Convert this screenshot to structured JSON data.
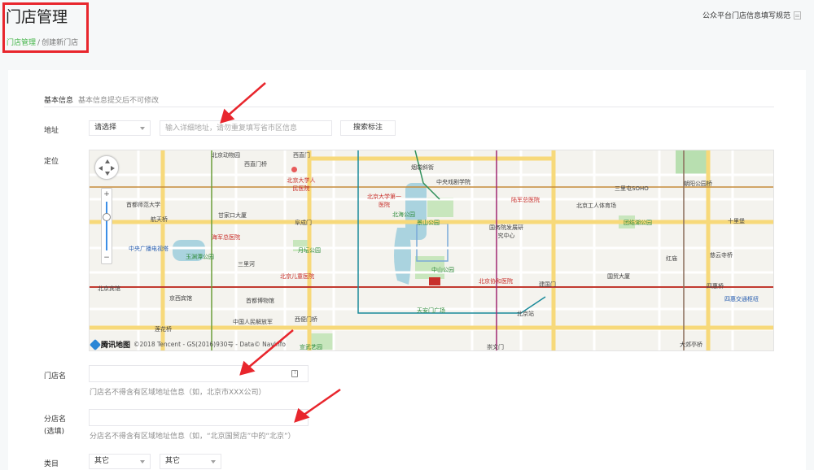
{
  "header": {
    "title": "门店管理",
    "breadcrumb_root": "门店管理",
    "breadcrumb_sep": "/",
    "breadcrumb_current": "创建新门店",
    "spec_link": "公众平台门店信息填写规范"
  },
  "basic_info": {
    "title": "基本信息",
    "subtitle": "基本信息提交后不可修改"
  },
  "address": {
    "label": "地址",
    "region_select": "请选择",
    "detail_placeholder": "输入详细地址，请勿重复填写省市区信息",
    "search_button": "搜索标注"
  },
  "location": {
    "label": "定位"
  },
  "map": {
    "logo_text": "腾讯地图",
    "copyright": "©2018 Tencent - GS(2016)930号 - Data© NavInfo",
    "labels": [
      {
        "text": "北京动物园",
        "cls": ""
      },
      {
        "text": "西直门桥",
        "cls": ""
      },
      {
        "text": "西直门",
        "cls": ""
      },
      {
        "text": "北京大学人民医院",
        "cls": "red"
      },
      {
        "text": "首都师范大学",
        "cls": ""
      },
      {
        "text": "航天桥",
        "cls": ""
      },
      {
        "text": "甘家口大厦",
        "cls": ""
      },
      {
        "text": "阜成门",
        "cls": ""
      },
      {
        "text": "海军总医院",
        "cls": "red"
      },
      {
        "text": "中央广播电视塔",
        "cls": "blue"
      },
      {
        "text": "玉渊潭公园",
        "cls": "green"
      },
      {
        "text": "三里河",
        "cls": ""
      },
      {
        "text": "月坛公园",
        "cls": "green"
      },
      {
        "text": "北京儿童医院",
        "cls": "red"
      },
      {
        "text": "北京宾馆",
        "cls": ""
      },
      {
        "text": "京西宾馆",
        "cls": ""
      },
      {
        "text": "首都博物馆",
        "cls": ""
      },
      {
        "text": "中国人民解放军",
        "cls": ""
      },
      {
        "text": "西便门桥",
        "cls": ""
      },
      {
        "text": "莲花桥",
        "cls": ""
      },
      {
        "text": "宣武艺园",
        "cls": "green"
      },
      {
        "text": "烟袋斜街",
        "cls": ""
      },
      {
        "text": "中央戏剧学院",
        "cls": ""
      },
      {
        "text": "北京大学第一医院",
        "cls": "red"
      },
      {
        "text": "北海公园",
        "cls": "green"
      },
      {
        "text": "景山公园",
        "cls": "green"
      },
      {
        "text": "陆军总医院",
        "cls": "red"
      },
      {
        "text": "国务院发展研究中心",
        "cls": ""
      },
      {
        "text": "中山公园",
        "cls": "green"
      },
      {
        "text": "北京协和医院",
        "cls": "red"
      },
      {
        "text": "天安门广场",
        "cls": "green"
      },
      {
        "text": "北京站",
        "cls": ""
      },
      {
        "text": "崇文门",
        "cls": ""
      },
      {
        "text": "建国门",
        "cls": ""
      },
      {
        "text": "北京工人体育场",
        "cls": ""
      },
      {
        "text": "三里屯SOHO",
        "cls": ""
      },
      {
        "text": "朝阳公园桥",
        "cls": ""
      },
      {
        "text": "团结湖公园",
        "cls": "green"
      },
      {
        "text": "十里堡",
        "cls": ""
      },
      {
        "text": "慈云寺桥",
        "cls": ""
      },
      {
        "text": "国贸大厦",
        "cls": ""
      },
      {
        "text": "四惠桥",
        "cls": ""
      },
      {
        "text": "四惠交通枢纽",
        "cls": "blue"
      },
      {
        "text": "大郊亭桥",
        "cls": ""
      },
      {
        "text": "红庙",
        "cls": ""
      }
    ]
  },
  "store_name": {
    "label": "门店名",
    "value": "",
    "hint": "门店名不得含有区域地址信息（如，北京市XXX公司）"
  },
  "branch_name": {
    "label": "分店名",
    "optional": "(选填)",
    "value": "",
    "hint": "分店名不得含有区域地址信息（如，“北京国贸店”中的“北京”）"
  },
  "category": {
    "label": "类目",
    "primary": "其它",
    "secondary": "其它"
  },
  "colors": {
    "accent_green": "#44b549",
    "annotation_red": "#e8262d"
  }
}
